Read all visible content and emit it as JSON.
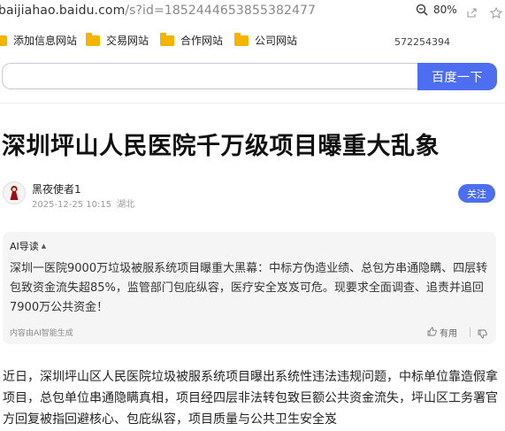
{
  "address_bar": {
    "url_host": "baijiahao.baidu.com",
    "url_path": "/s?id=1852444653855382477",
    "zoom": "80%"
  },
  "bookmarks": {
    "items": [
      {
        "label": "添加信息网站"
      },
      {
        "label": "交易网站"
      },
      {
        "label": "合作网站"
      },
      {
        "label": "公司网站"
      }
    ],
    "extra_number": "572254394"
  },
  "search": {
    "value": "",
    "button_label": "百度一下"
  },
  "article": {
    "title": "深圳坪山人民医院千万级项目曝重大乱象",
    "author": "黑夜使者1",
    "date": "2025-12-25 10:15",
    "location": "湖北",
    "follow_label": "关注",
    "ai_summary": {
      "heading": "AI导读",
      "text": "深圳一医院9000万垃圾被服系统项目曝重大黑幕：中标方伪造业绩、总包方串通隐瞒、四层转包致资金流失超85%，监管部门包庇纵容，医疗安全岌岌可危。现要求全面调查、追责并追回7900万公共资金！",
      "note": "内容由AI智能生成",
      "useful_label": "有用"
    },
    "body": "近日，深圳坪山区人民医院垃圾被服系统项目曝出系统性违法违规问题，中标单位靠造假拿项目，总包单位串通隐瞒真相，项目经四层非法转包致巨额公共资金流失，坪山区工务署官方回复被指回避核心、包庇纵容，项目质量与公共卫生安全岌"
  },
  "colors": {
    "accent": "#4e6ef2",
    "folder": "#f4b400"
  }
}
